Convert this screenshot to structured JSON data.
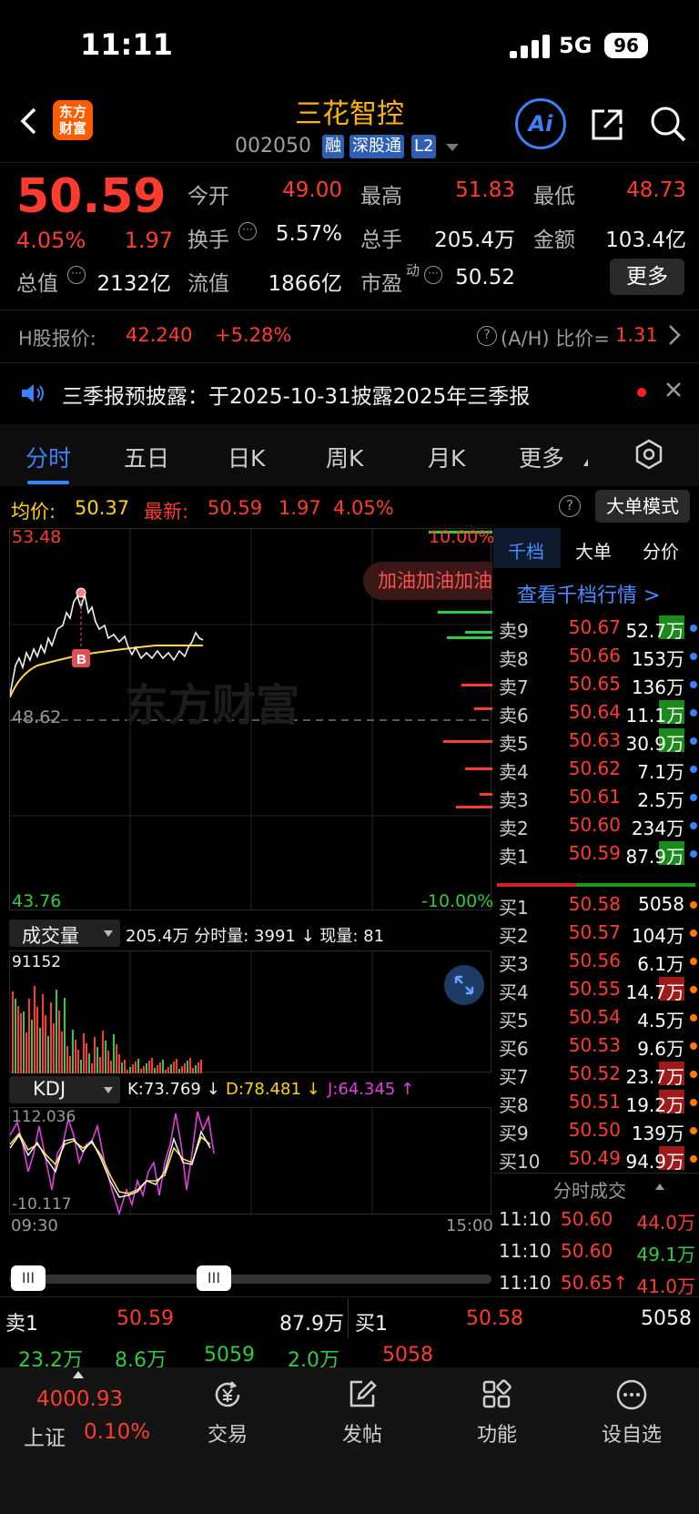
{
  "status": {
    "time": "11:11",
    "network": "5G",
    "battery": "96"
  },
  "header": {
    "logo_line1": "东方",
    "logo_line2": "财富",
    "stock_name": "三花智控",
    "stock_code": "002050",
    "tags": [
      "融",
      "深股通",
      "L2"
    ]
  },
  "quote": {
    "price": "50.59",
    "change_pct": "4.05%",
    "change": "1.97",
    "open_label": "今开",
    "open": "49.00",
    "high_label": "最高",
    "high": "51.83",
    "low_label": "最低",
    "low": "48.73",
    "turnover_label": "换手",
    "turnover": "5.57%",
    "volume_label": "总手",
    "volume": "205.4万",
    "amount_label": "金额",
    "amount": "103.4亿",
    "mcap_label": "总值",
    "mcap": "2132亿",
    "float_label": "流值",
    "float_cap": "1866亿",
    "pe_label": "市盈",
    "pe_super": "动",
    "pe": "50.52",
    "more": "更多"
  },
  "hshare": {
    "label": "H股报价:",
    "price": "42.240",
    "pct": "+5.28%",
    "ah_label": "(A/H) 比价=",
    "ah_value": "1.31"
  },
  "notice": {
    "text": "三季报预披露：于2025-10-31披露2025年三季报"
  },
  "tabs": [
    "分时",
    "五日",
    "日K",
    "周K",
    "月K",
    "更多"
  ],
  "avg": {
    "avg_label": "均价:",
    "avg_value": "50.37",
    "latest_label": "最新:",
    "latest": "50.59",
    "chg": "1.97",
    "pct": "4.05%",
    "big_mode": "大单模式"
  },
  "chart": {
    "top_price": "53.48",
    "mid_price": "48.62",
    "bottom_price": "43.76",
    "top_pct": "10.00%",
    "bottom_pct": "-10.00%",
    "watermark": "东方财富",
    "bubble": "加油加油加油",
    "buy_marker": "B",
    "vol_label": "成交量",
    "vol_info": "205.4万 分时量: 3991 ↓ 现量: 81",
    "vol_max": "91152",
    "kdj_label": "KDJ",
    "k": "K:73.769 ↓",
    "d": "D:78.481 ↓",
    "j": "J:64.345 ↑",
    "kdj_max": "112.036",
    "kdj_min": "-10.117",
    "t_start": "09:30",
    "t_end": "15:00"
  },
  "book": {
    "tabs": [
      "千档",
      "大单",
      "分价"
    ],
    "link": "查看千档行情 >",
    "asks": [
      {
        "label": "卖9",
        "price": "50.67",
        "vol": "52.7万"
      },
      {
        "label": "卖8",
        "price": "50.66",
        "vol": "153万"
      },
      {
        "label": "卖7",
        "price": "50.65",
        "vol": "136万"
      },
      {
        "label": "卖6",
        "price": "50.64",
        "vol": "11.1万"
      },
      {
        "label": "卖5",
        "price": "50.63",
        "vol": "30.9万"
      },
      {
        "label": "卖4",
        "price": "50.62",
        "vol": "7.1万"
      },
      {
        "label": "卖3",
        "price": "50.61",
        "vol": "2.5万"
      },
      {
        "label": "卖2",
        "price": "50.60",
        "vol": "234万"
      },
      {
        "label": "卖1",
        "price": "50.59",
        "vol": "87.9万"
      }
    ],
    "bids": [
      {
        "label": "买1",
        "price": "50.58",
        "vol": "5058"
      },
      {
        "label": "买2",
        "price": "50.57",
        "vol": "104万"
      },
      {
        "label": "买3",
        "price": "50.56",
        "vol": "6.1万"
      },
      {
        "label": "买4",
        "price": "50.55",
        "vol": "14.7万"
      },
      {
        "label": "买5",
        "price": "50.54",
        "vol": "4.5万"
      },
      {
        "label": "买6",
        "price": "50.53",
        "vol": "9.6万"
      },
      {
        "label": "买7",
        "price": "50.52",
        "vol": "23.7万"
      },
      {
        "label": "买8",
        "price": "50.51",
        "vol": "19.2万"
      },
      {
        "label": "买9",
        "price": "50.50",
        "vol": "139万"
      },
      {
        "label": "买10",
        "price": "50.49",
        "vol": "94.9万"
      }
    ],
    "trades_title": "分时成交",
    "trades": [
      {
        "time": "11:10",
        "price": "50.60",
        "vol": "44.0万"
      },
      {
        "time": "11:10",
        "price": "50.60",
        "vol": "49.1万"
      },
      {
        "time": "11:10",
        "price": "50.65↑",
        "vol": "41.0万"
      }
    ]
  },
  "bottom": {
    "sell1_label": "卖1",
    "sell1_price": "50.59",
    "sell1_vol": "87.9万",
    "buy1_label": "买1",
    "buy1_price": "50.58",
    "buy1_vol": "5058",
    "row2": [
      "23.2万",
      "8.6万",
      "5059",
      "2.0万",
      "5058"
    ]
  },
  "nav": {
    "index_value": "4000.93",
    "index_name": "上证",
    "index_pct": "0.10%",
    "items": [
      "交易",
      "发帖",
      "功能",
      "设自选"
    ]
  }
}
